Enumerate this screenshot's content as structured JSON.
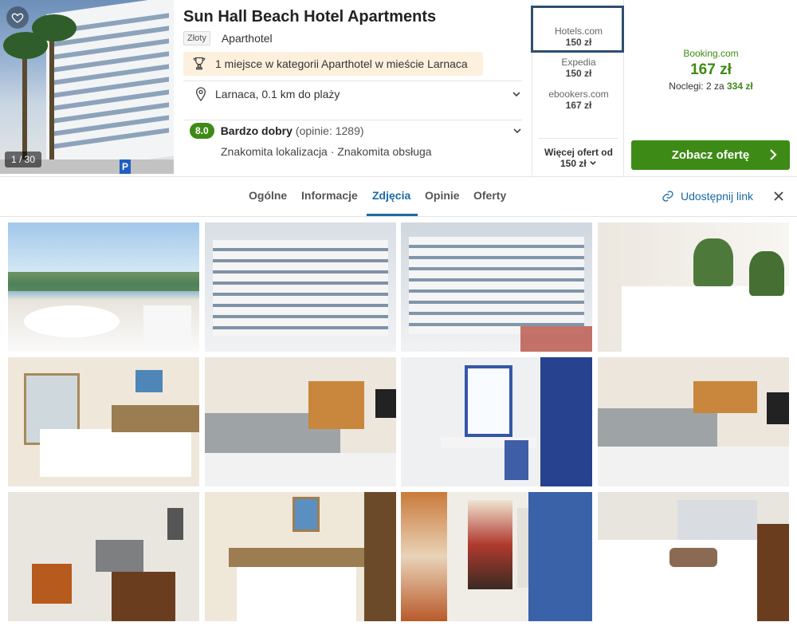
{
  "hotel": {
    "name": "Sun Hall Beach Hotel Apartments",
    "badge": "Złoty",
    "type": "Aparthotel",
    "award": "1 miejsce w kategorii Aparthotel w mieście Larnaca",
    "location": "Larnaca, 0.1 km do plaży",
    "score": "8.0",
    "rating_label": "Bardzo dobry",
    "rating_count": "(opinie: 1289)",
    "highlights": "Znakomita lokalizacja · Znakomita obsługa",
    "photo_counter": "1 / 30"
  },
  "offers": [
    {
      "provider": "Hotels.com",
      "price": "150 zł"
    },
    {
      "provider": "Expedia",
      "price": "150 zł"
    },
    {
      "provider": "ebookers.com",
      "price": "167 zł"
    }
  ],
  "more_offers": {
    "line1": "Więcej ofert od",
    "line2": "150 zł"
  },
  "best_deal": {
    "provider": "Booking.com",
    "price": "167 zł",
    "nights_prefix": "Noclegi: 2 za",
    "total": "334 zł",
    "cta": "Zobacz ofertę"
  },
  "tabs": [
    {
      "label": "Ogólne"
    },
    {
      "label": "Informacje"
    },
    {
      "label": "Zdjęcia"
    },
    {
      "label": "Opinie"
    },
    {
      "label": "Oferty"
    }
  ],
  "active_tab": "Zdjęcia",
  "share_label": "Udostępnij link",
  "colors": {
    "accent_green": "#3e8a16",
    "link_blue": "#1a6aa6",
    "award_bg": "#fdf0dd",
    "highlight_border": "#2f4f6f"
  },
  "icons": [
    "heart-icon",
    "trophy-icon",
    "location-pin-icon",
    "chevron-down-icon",
    "chevron-right-icon",
    "link-icon",
    "close-icon"
  ]
}
